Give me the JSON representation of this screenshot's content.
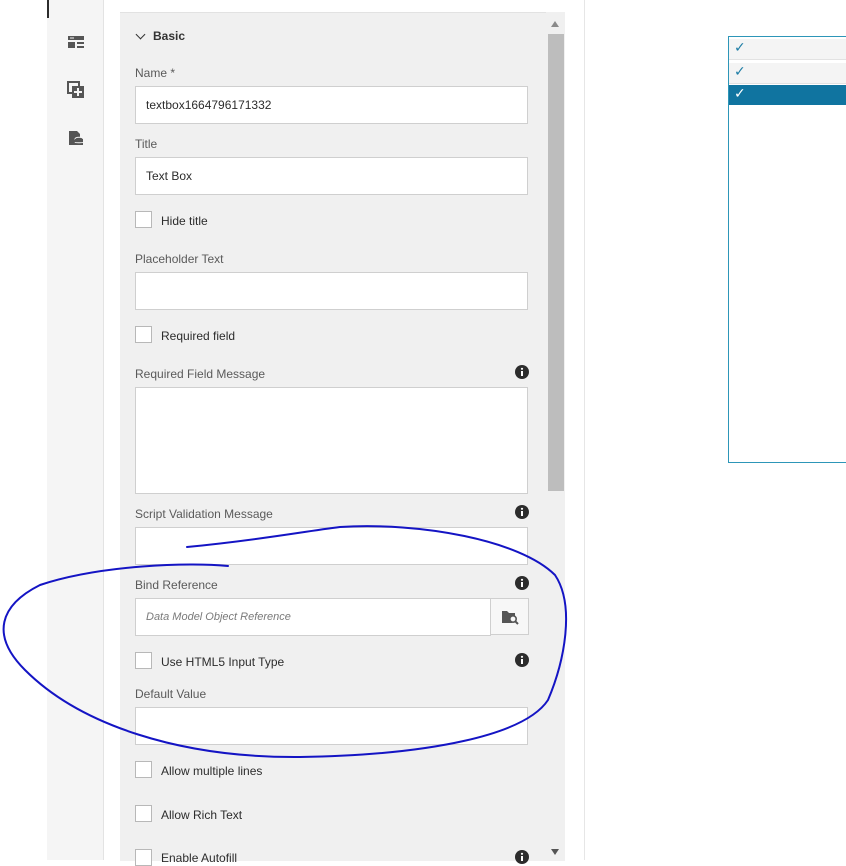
{
  "panel": {
    "section_title": "Basic",
    "fields": {
      "name": {
        "label": "Name *",
        "value": "textbox1664796171332"
      },
      "title": {
        "label": "Title",
        "value": "Text Box"
      },
      "hide_title": {
        "label": "Hide title",
        "checked": false
      },
      "placeholder_text": {
        "label": "Placeholder Text",
        "value": ""
      },
      "required_field": {
        "label": "Required field",
        "checked": false
      },
      "required_field_message": {
        "label": "Required Field Message",
        "value": ""
      },
      "script_validation_message": {
        "label": "Script Validation Message",
        "value": ""
      },
      "bind_reference": {
        "label": "Bind Reference",
        "placeholder": "Data Model Object Reference"
      },
      "use_html5_input_type": {
        "label": "Use HTML5 Input Type",
        "checked": false
      },
      "default_value": {
        "label": "Default Value",
        "value": ""
      },
      "allow_multiple_lines": {
        "label": "Allow multiple lines",
        "checked": false
      },
      "allow_rich_text": {
        "label": "Allow Rich Text",
        "checked": false
      },
      "enable_autofill": {
        "label": "Enable Autofill",
        "checked": false
      }
    }
  },
  "sidebar": {
    "icons": [
      "form-objects-icon",
      "add-component-icon",
      "data-sources-icon"
    ]
  },
  "list": {
    "rows": [
      {
        "check": "✓",
        "selected": false
      },
      {
        "check": "✓",
        "selected": false
      },
      {
        "check": "✓",
        "selected": true
      }
    ]
  },
  "colors": {
    "accent": "#1074a0",
    "annotation": "#1010c8",
    "panel_bg": "#f0f0f0"
  }
}
